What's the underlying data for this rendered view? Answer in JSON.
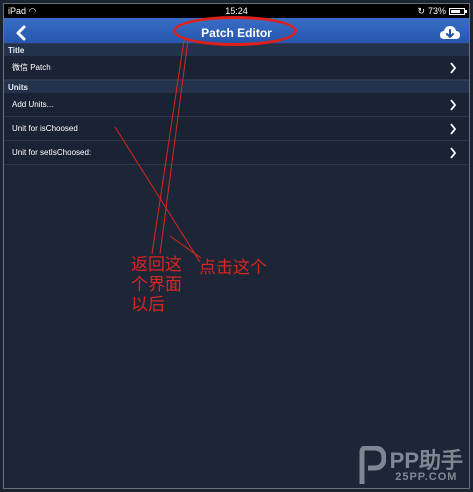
{
  "status_bar": {
    "device": "iPad",
    "time": "15:24",
    "battery": "73%",
    "battery_level": 0.73
  },
  "nav": {
    "title": "Patch Editor",
    "back_icon": "chevron-left-icon",
    "cloud_icon": "cloud-download-icon"
  },
  "sections": [
    {
      "header": "Title",
      "rows": [
        {
          "label": "微信 Patch"
        }
      ]
    },
    {
      "header": "Units",
      "rows": [
        {
          "label": "Add Units..."
        },
        {
          "label": "Unit for isChoosed"
        },
        {
          "label": "Unit for setIsChoosed:"
        }
      ]
    }
  ],
  "annotations": {
    "left_text": "返回这\n个界面\n以后",
    "right_text": "点击这个",
    "color": "#d9261c"
  },
  "watermark": {
    "brand": "PP助手",
    "site": "25PP.COM"
  }
}
